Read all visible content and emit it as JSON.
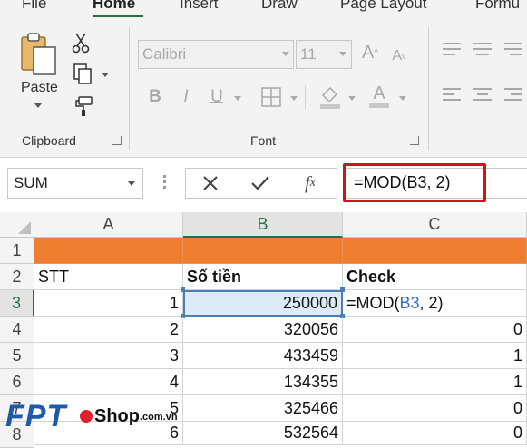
{
  "ribbon": {
    "tabs": [
      "File",
      "Home",
      "Insert",
      "Draw",
      "Page Layout",
      "Formu"
    ],
    "clipboard": {
      "paste_label": "Paste",
      "group_label": "Clipboard"
    },
    "font": {
      "name": "Calibri",
      "size": "11",
      "group_label": "Font"
    }
  },
  "formula_bar": {
    "name_box": "SUM",
    "formula": "=MOD(B3, 2)"
  },
  "grid": {
    "columns": [
      "A",
      "B",
      "C"
    ],
    "rows": [
      "1",
      "2",
      "3",
      "4",
      "5",
      "6",
      "7",
      "8"
    ],
    "header_row": {
      "a": "STT",
      "b": "Số tiền",
      "c": "Check"
    },
    "edit_cell": {
      "prefix": "=MOD(",
      "ref": "B3",
      "suffix": ", 2)"
    },
    "data": [
      {
        "a": "1",
        "b": "250000",
        "c": ""
      },
      {
        "a": "2",
        "b": "320056",
        "c": "0"
      },
      {
        "a": "3",
        "b": "433459",
        "c": "1"
      },
      {
        "a": "4",
        "b": "134355",
        "c": "1"
      },
      {
        "a": "5",
        "b": "325466",
        "c": "0"
      },
      {
        "a": "6",
        "b": "532564",
        "c": "0"
      }
    ]
  },
  "watermark": {
    "brand": "FPT",
    "shop": "Shop",
    "domain": ".com.vn"
  },
  "colors": {
    "accent": "#217346",
    "header_fill": "#ed7d31",
    "highlight": "#d0141a"
  }
}
